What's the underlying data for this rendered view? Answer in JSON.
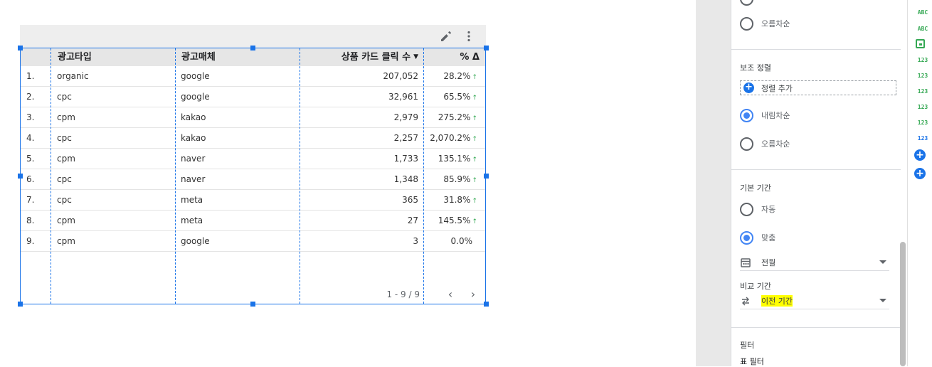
{
  "table": {
    "headers": [
      "광고타입",
      "광고매체",
      "상품 카드 클릭 수",
      "% Δ"
    ],
    "sort_indicator": "▼",
    "rows": [
      {
        "idx": "1.",
        "type": "organic",
        "media": "google",
        "clicks": "207,052",
        "delta": "28.2%",
        "up": true
      },
      {
        "idx": "2.",
        "type": "cpc",
        "media": "google",
        "clicks": "32,961",
        "delta": "65.5%",
        "up": true
      },
      {
        "idx": "3.",
        "type": "cpm",
        "media": "kakao",
        "clicks": "2,979",
        "delta": "275.2%",
        "up": true
      },
      {
        "idx": "4.",
        "type": "cpc",
        "media": "kakao",
        "clicks": "2,257",
        "delta": "2,070.2%",
        "up": true
      },
      {
        "idx": "5.",
        "type": "cpm",
        "media": "naver",
        "clicks": "1,733",
        "delta": "135.1%",
        "up": true
      },
      {
        "idx": "6.",
        "type": "cpc",
        "media": "naver",
        "clicks": "1,348",
        "delta": "85.9%",
        "up": true
      },
      {
        "idx": "7.",
        "type": "cpc",
        "media": "meta",
        "clicks": "365",
        "delta": "31.8%",
        "up": true
      },
      {
        "idx": "8.",
        "type": "cpm",
        "media": "meta",
        "clicks": "27",
        "delta": "145.5%",
        "up": true
      },
      {
        "idx": "9.",
        "type": "cpm",
        "media": "google",
        "clicks": "3",
        "delta": "0.0%",
        "up": false
      }
    ],
    "pager_text": "1 - 9 / 9",
    "prev_icon": "‹",
    "next_icon": "›"
  },
  "panel": {
    "sort_asc_top": "오름차순",
    "secondary_sort_title": "보조 정렬",
    "add_sort_label": "정렬 추가",
    "secondary_desc": "내림차순",
    "secondary_asc": "오름차순",
    "default_range_title": "기본 기간",
    "range_auto": "자동",
    "range_custom": "맞춤",
    "range_value": "전월",
    "compare_title": "비교 기간",
    "compare_value": "이전 기간",
    "filter_title": "필터",
    "table_filter": "표 필터"
  },
  "fields": {
    "types": [
      "ABC",
      "ABC",
      "date",
      "123",
      "123",
      "123",
      "123",
      "123",
      "123"
    ]
  },
  "colors": {
    "selection": "#1a73e8",
    "positive": "#34a853",
    "highlight": "#ffff00"
  }
}
